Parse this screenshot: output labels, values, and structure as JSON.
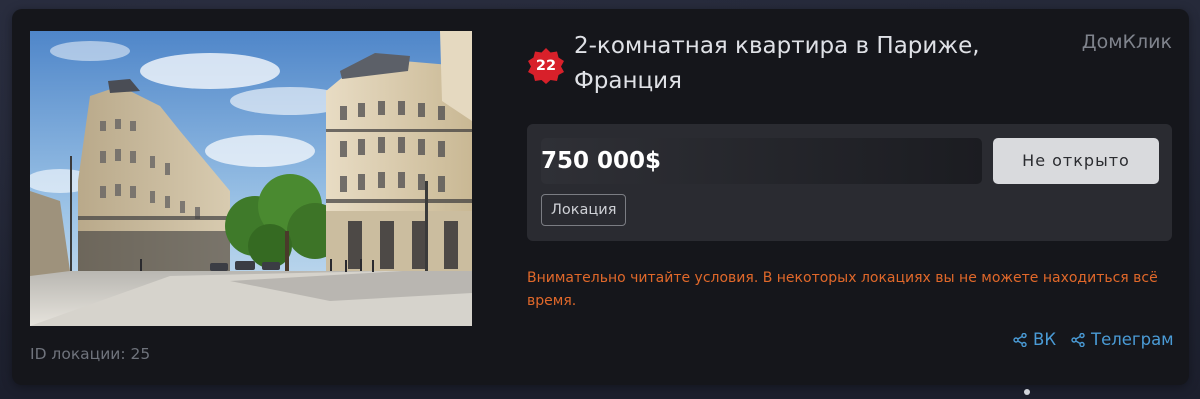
{
  "listing": {
    "badge_number": "22",
    "title_line1": "2-комнатная квартира в Париже,",
    "title_line2": "Франция",
    "brand": "ДомКлик",
    "price": "750 000$",
    "open_button_label": "Не открыто",
    "location_tag": "Локация",
    "warning_text": "Внимательно читайте условия. В некоторых локациях вы не можете находиться всё время.",
    "location_id_text": "ID локации: 25",
    "photo_subject": "Parisian street with Haussmann buildings"
  },
  "share": {
    "vk_label": "ВК",
    "telegram_label": "Телеграм",
    "icon": "share-icon"
  },
  "colors": {
    "card_background": "#15161b",
    "badge_red": "#d8202a",
    "warning_orange": "#e0682a",
    "link_blue": "#4a9bd6",
    "button_light": "#d9dadd"
  }
}
